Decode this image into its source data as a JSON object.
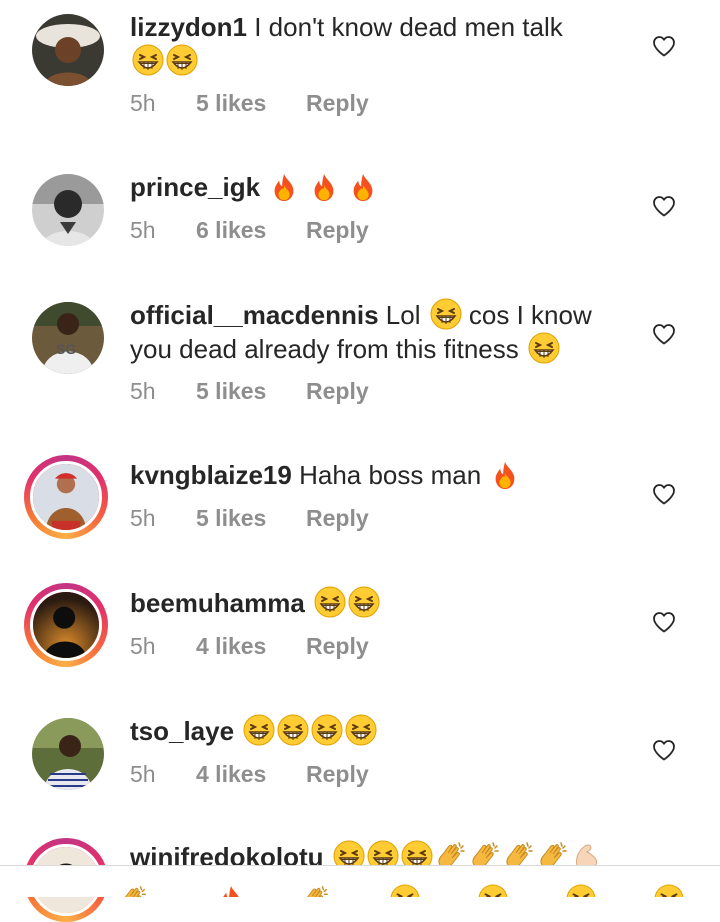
{
  "comments": [
    {
      "username": "lizzydon1",
      "text": " I don't know dead men talk ",
      "emojis": [
        "grin",
        "grin"
      ],
      "time": "5h",
      "likes": "5 likes",
      "reply": "Reply"
    },
    {
      "username": "prince_igk",
      "text": " ",
      "emojis": [
        "fire",
        "fire",
        "fire"
      ],
      "time": "5h",
      "likes": "6 likes",
      "reply": "Reply"
    },
    {
      "username": "official__macdennis",
      "text": " Lol ",
      "text2": " cos I know you dead already from this fitness ",
      "time": "5h",
      "likes": "5 likes",
      "reply": "Reply"
    },
    {
      "username": "kvngblaize19",
      "text": " Haha boss man ",
      "emojis": [
        "fire"
      ],
      "time": "5h",
      "likes": "5 likes",
      "reply": "Reply"
    },
    {
      "username": "beemuhamma",
      "text": " ",
      "emojis": [
        "grin",
        "grin"
      ],
      "time": "5h",
      "likes": "4 likes",
      "reply": "Reply"
    },
    {
      "username": "tso_laye",
      "text": " ",
      "emojis": [
        "grin",
        "grin",
        "grin",
        "grin"
      ],
      "time": "5h",
      "likes": "4 likes",
      "reply": "Reply"
    },
    {
      "username": "winifredokolotu",
      "text": " ",
      "emojis": [
        "grin",
        "grin",
        "grin",
        "clap",
        "clap",
        "clap",
        "clap",
        "muscle"
      ]
    }
  ],
  "icons": {
    "heart": "heart-outline-icon",
    "grin": "grinning-squinting-face-emoji",
    "fire": "fire-emoji",
    "clap": "clapping-hands-emoji",
    "muscle": "flexed-biceps-emoji"
  },
  "colors": {
    "text": "#262626",
    "meta": "#8e8e8e",
    "divider": "#dbdbdb"
  }
}
